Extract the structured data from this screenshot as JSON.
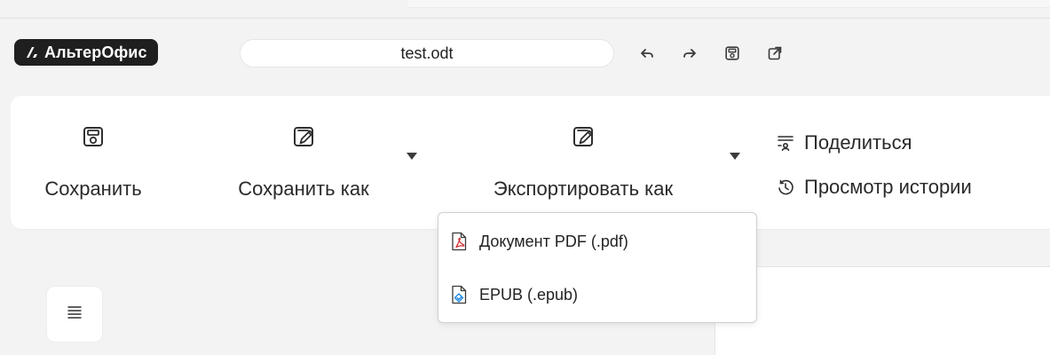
{
  "brand": {
    "name": "АльтерОфис",
    "colors": {
      "bg": "#1f1f1f",
      "text": "#ffffff"
    }
  },
  "document": {
    "title": "test.odt"
  },
  "top_actions": [
    {
      "icon": "undo-icon"
    },
    {
      "icon": "redo-icon"
    },
    {
      "icon": "save-icon"
    },
    {
      "icon": "open-external-icon"
    }
  ],
  "ribbon": {
    "save_label": "Сохранить",
    "save_as_label": "Сохранить как",
    "export_as_label": "Экспортировать как",
    "share_label": "Поделиться",
    "history_label": "Просмотр истории"
  },
  "export_menu": {
    "items": [
      {
        "label": "Документ PDF (.pdf)",
        "icon": "pdf-file-icon",
        "icon_color": "#d32f2f"
      },
      {
        "label": "EPUB (.epub)",
        "icon": "epub-file-icon",
        "icon_color": "#1e88e5"
      }
    ]
  },
  "colors": {
    "accent_dark": "#1f1f1f",
    "text": "#2a2a2a",
    "app_bg": "#f3f3f3",
    "panel": "#ffffff"
  }
}
